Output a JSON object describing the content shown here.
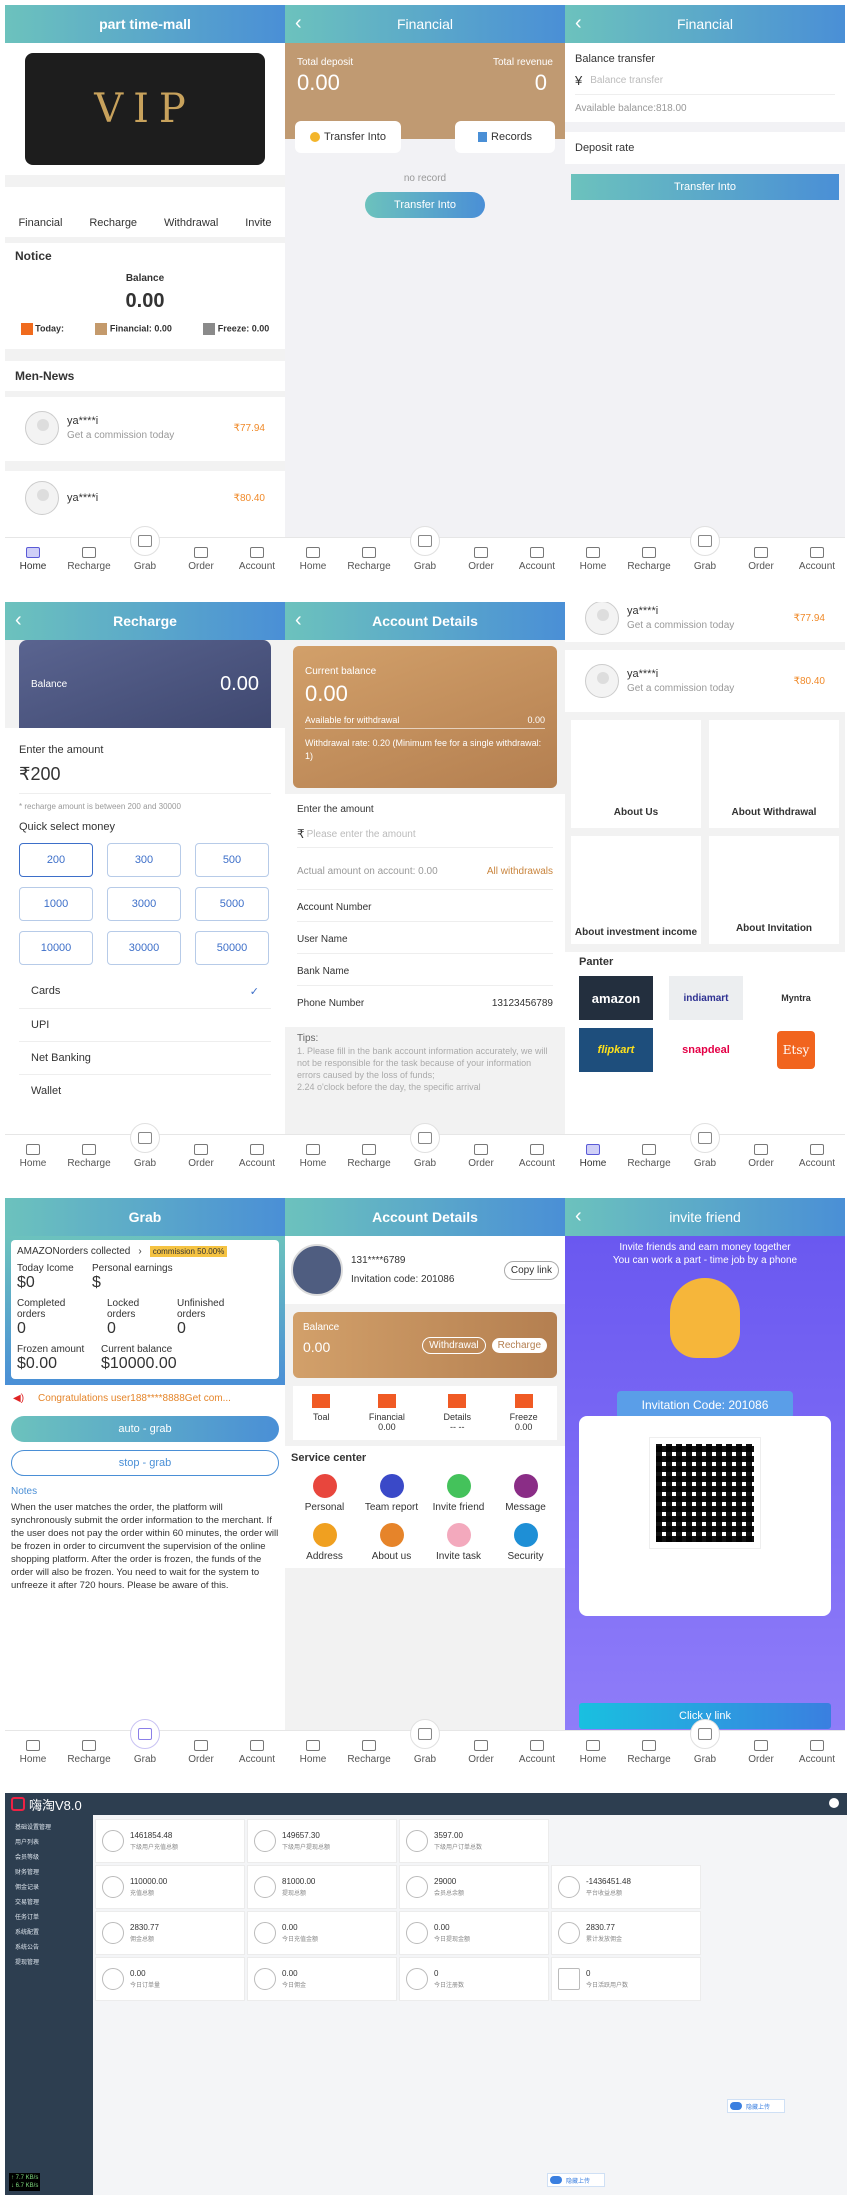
{
  "tabbar": {
    "home": "Home",
    "recharge": "Recharge",
    "grab": "Grab",
    "order": "Order",
    "account": "Account"
  },
  "s1": {
    "title": "part time-mall",
    "banner_text": "VIP",
    "nav": [
      "Financial",
      "Recharge",
      "Withdrawal",
      "Invite"
    ],
    "notice": "Notice",
    "balance_label": "Balance",
    "balance_value": "0.00",
    "today_label": "Today:",
    "financial_label": "Financial:",
    "financial_value": "0.00",
    "freeze_label": "Freeze:",
    "freeze_value": "0.00",
    "news_title": "Men-News",
    "news": [
      {
        "user": "ya****i",
        "desc": "Get a commission today",
        "amount": "₹77.94"
      },
      {
        "user": "ya****i",
        "desc": "",
        "amount": "₹80.40"
      }
    ]
  },
  "s2": {
    "title": "Financial",
    "total_deposit_label": "Total deposit",
    "total_deposit_value": "0.00",
    "total_revenue_label": "Total revenue",
    "total_revenue_value": "0",
    "transfer_into": "Transfer Into",
    "records": "Records",
    "no_record": "no record",
    "transfer_btn": "Transfer Into"
  },
  "s3": {
    "title": "Financial",
    "balance_transfer": "Balance transfer",
    "currency": "¥",
    "placeholder": "Balance transfer",
    "available": "Available balance:818.00",
    "deposit_rate": "Deposit rate",
    "btn": "Transfer Into"
  },
  "s4": {
    "title": "Recharge",
    "balance_label": "Balance",
    "balance_value": "0.00",
    "enter_amount": "Enter the amount",
    "amount": "₹200",
    "hint": "* recharge amount is between 200 and 30000",
    "quick": "Quick select money",
    "options": [
      "200",
      "300",
      "500",
      "1000",
      "3000",
      "5000",
      "10000",
      "30000",
      "50000"
    ],
    "methods": [
      "Cards",
      "UPI",
      "Net Banking",
      "Wallet"
    ]
  },
  "s5": {
    "title": "Account Details",
    "current_balance": "Current balance",
    "balance": "0.00",
    "available_label": "Available for withdrawal",
    "available_value": "0.00",
    "rate_text": "Withdrawal rate: 0.20   (Minimum fee for a single withdrawal:  1)",
    "enter_amount": "Enter the amount",
    "currency": "₹",
    "placeholder": "Please enter the amount",
    "actual": "Actual amount on account:  0.00",
    "all_withdrawals": "All withdrawals",
    "fields": [
      "Account Number",
      "User Name",
      "Bank Name",
      "Phone Number"
    ],
    "phone": "13123456789",
    "tips_title": "Tips:",
    "tips": "1. Please fill in the bank account information accurately, we will not be responsible for the task because of your information errors caused by the loss of funds;",
    "tips2": "2.24 o'clock before the        day, the specific arrival"
  },
  "s6": {
    "news": [
      {
        "user": "ya****i",
        "desc": "Get a commission today",
        "amount": "₹77.94"
      },
      {
        "user": "ya****i",
        "desc": "Get a commission today",
        "amount": "₹80.40"
      }
    ],
    "tiles": [
      "About Us",
      "About Withdrawal",
      "About investment income",
      "About Invitation"
    ],
    "panter": "Panter",
    "brands": [
      "amazon",
      "indiamart",
      "Myntra",
      "flipkart",
      "snapdeal",
      "Etsy"
    ]
  },
  "s7": {
    "title": "Grab",
    "collected": "AMAZONorders collected",
    "commission": "commission 50.00%",
    "today_income_label": "Today Icome",
    "today_income": "$0",
    "personal_label": "Personal earnings",
    "personal": "$",
    "completed_label": "Completed orders",
    "completed": "0",
    "locked_label": "Locked orders",
    "locked": "0",
    "unfinished_label": "Unfinished orders",
    "unfinished": "0",
    "frozen_label": "Frozen amount",
    "frozen": "$0.00",
    "current_label": "Current balance",
    "current": "$10000.00",
    "marquee": "Congratulations user188****8888Get com...",
    "auto": "auto - grab",
    "stop": "stop - grab",
    "notes_title": "Notes",
    "notes": "When the user matches the order, the platform will synchronously submit the order information to the merchant.  If the user does not pay the order within 60  minutes, the order will be frozen in order to circumvent the supervision of the online shopping platform.  After the order is frozen, the funds of the order will also be frozen. You need to wait for the system to unfreeze it after 720 hours. Please be aware of this."
  },
  "s8": {
    "title": "Account Details",
    "phone": "131****6789",
    "copy": "Copy link",
    "invite": "Invitation code:  201086",
    "balance_label": "Balance",
    "balance": "0.00",
    "withdrawal": "Withdrawal",
    "recharge": "Recharge",
    "stats": [
      {
        "label": "Toal",
        "value": ""
      },
      {
        "label": "Financial",
        "value": "0.00"
      },
      {
        "label": "Details",
        "value": "-- --"
      },
      {
        "label": "Freeze",
        "value": "0.00"
      }
    ],
    "service": "Service center",
    "items": [
      "Personal",
      "Team report",
      "Invite friend",
      "Message",
      "Address",
      "About us",
      "Invite task",
      "Security"
    ]
  },
  "s9": {
    "title": "invite friend",
    "line1": "Invite friends and earn money together",
    "line2": "You can work a part - time job by a phone",
    "code": "Invitation Code:  201086",
    "link": "Click        y link"
  },
  "admin": {
    "title": "嗨淘V8.0",
    "menu": [
      "基础设置管理",
      "用户列表",
      "会员等级",
      "财务管理",
      "佣金记录",
      "交易管理",
      "任务订单",
      "系统配置",
      "系统公告",
      "提现管理"
    ],
    "speeds": [
      "↑ 7.7 KB/s",
      "↓ 6.7 KB/s"
    ],
    "cards": [
      {
        "v": "1461854.48",
        "l": "下级用户充值总额"
      },
      {
        "v": "149657.30",
        "l": "下级用户提现总额"
      },
      {
        "v": "3597.00",
        "l": "下级用户订单总数"
      },
      {
        "v": "110000.00",
        "l": "充值总额"
      },
      {
        "v": "81000.00",
        "l": "提现总额"
      },
      {
        "v": "29000",
        "l": "会员总余额"
      },
      {
        "v": "-1436451.48",
        "l": "平台收益总额"
      },
      {
        "v": "2830.77",
        "l": "佣金总额"
      },
      {
        "v": "0.00",
        "l": "今日充值金额"
      },
      {
        "v": "0.00",
        "l": "今日提现金额"
      },
      {
        "v": "2830.77",
        "l": "累计发放佣金"
      },
      {
        "v": "0.00",
        "l": "今日订单量"
      },
      {
        "v": "0.00",
        "l": "今日佣金"
      },
      {
        "v": "0",
        "l": "今日注册数"
      },
      {
        "v": "0",
        "l": "今日活跃用户数"
      }
    ],
    "upload": "隐藏上传"
  }
}
